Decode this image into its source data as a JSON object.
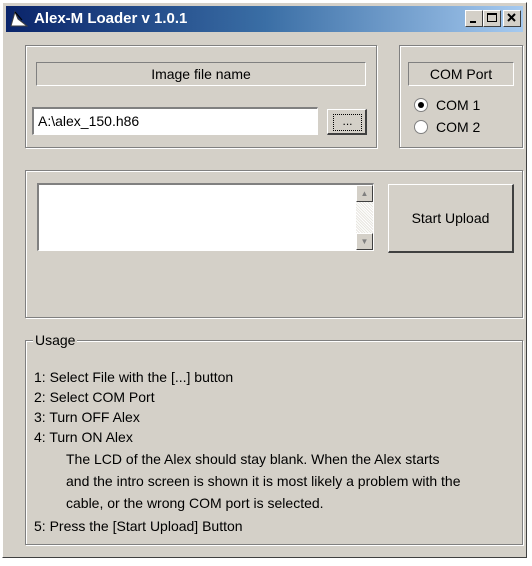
{
  "window": {
    "title": "Alex-M Loader v 1.0.1",
    "icons": {
      "app": "loader-app-icon",
      "minimize": "minimize-icon",
      "maximize": "maximize-icon",
      "close": "close-icon"
    }
  },
  "file_group": {
    "label": "Image file name",
    "path_value": "A:\\alex_150.h86",
    "browse_label": "..."
  },
  "com_group": {
    "label": "COM Port",
    "options": [
      {
        "label": "COM 1",
        "selected": true
      },
      {
        "label": "COM 2",
        "selected": false
      }
    ]
  },
  "upload_group": {
    "log_text": "",
    "start_label": "Start Upload"
  },
  "usage": {
    "title": "Usage",
    "lines": [
      "1: Select File with the [...] button",
      "2: Select COM Port",
      "3: Turn OFF Alex",
      "4: Turn ON Alex",
      "The LCD of the Alex should stay blank. When the Alex starts",
      "and the intro screen is shown it is most likely a problem with the",
      "cable, or the wrong COM port is selected.",
      "5: Press the [Start Upload] Button"
    ]
  },
  "colors": {
    "face": "#d4d0c8",
    "title_start": "#0a246a",
    "title_end": "#a6caf0"
  }
}
